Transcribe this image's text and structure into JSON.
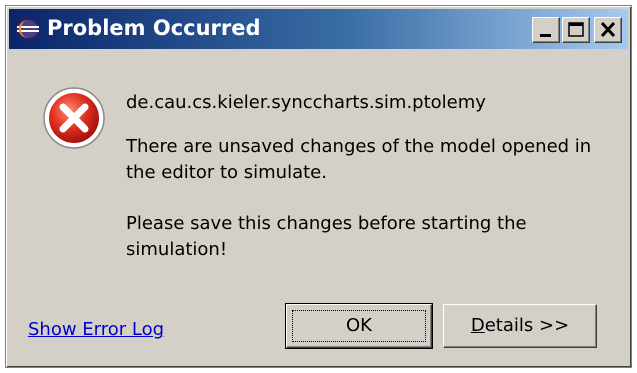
{
  "window": {
    "title": "Problem Occurred"
  },
  "message": {
    "plugin": "de.cau.cs.kieler.synccharts.sim.ptolemy",
    "line1": "There are unsaved changes of the model opened in the editor to simulate.",
    "line2": "Please save this changes before starting the simulation!"
  },
  "footer": {
    "link_label": "Show Error Log",
    "ok_label": "OK",
    "details_mnemonic": "D",
    "details_rest": "etails >>"
  },
  "colors": {
    "titlebar_start": "#0a246a",
    "titlebar_end": "#a6caf0",
    "dialog_bg": "#d4d0c8",
    "error_red": "#d42b1e",
    "link": "#0000cc"
  },
  "icons": {
    "title": "eclipse-icon",
    "error": "error-icon",
    "minimize": "minimize-icon",
    "maximize": "maximize-icon",
    "close": "close-icon"
  }
}
